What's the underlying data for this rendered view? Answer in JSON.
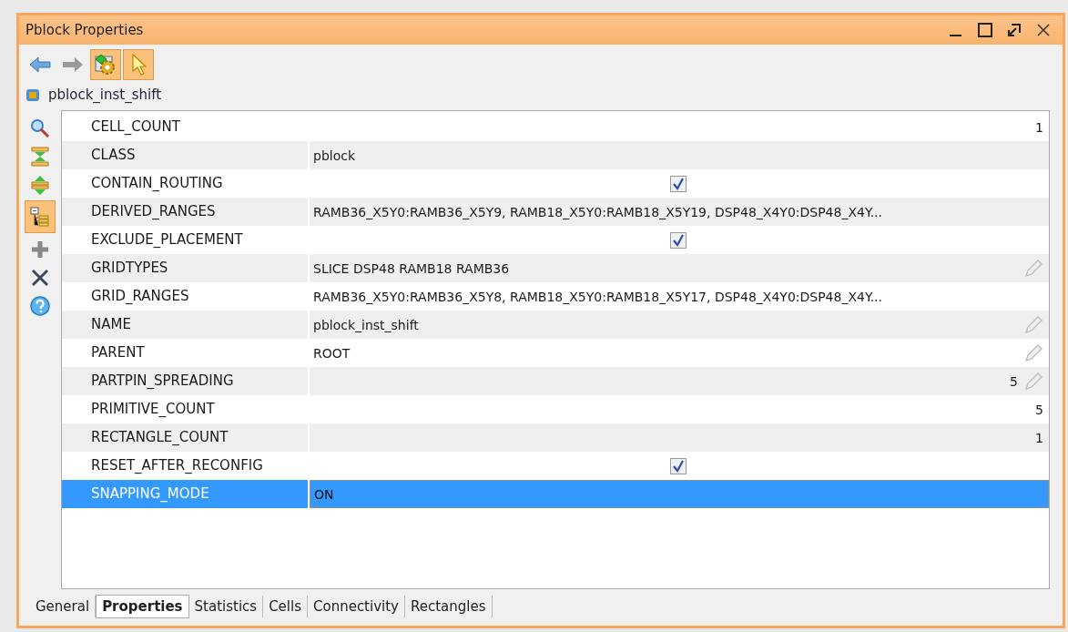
{
  "window": {
    "title": "Pblock Properties"
  },
  "toolbar": [
    {
      "kind": "back",
      "selected": false
    },
    {
      "kind": "forward",
      "selected": false
    },
    {
      "kind": "gear",
      "selected": true
    },
    {
      "kind": "cursor",
      "selected": true
    }
  ],
  "object": {
    "name": "pblock_inst_shift"
  },
  "side_tools": [
    {
      "kind": "search",
      "selected": false
    },
    {
      "kind": "collapse",
      "selected": false
    },
    {
      "kind": "expand",
      "selected": false
    },
    {
      "kind": "tree",
      "selected": true
    },
    {
      "kind": "add",
      "selected": false
    },
    {
      "kind": "remove",
      "selected": false
    },
    {
      "kind": "help",
      "selected": false
    }
  ],
  "properties": [
    {
      "name": "CELL_COUNT",
      "kind": "number",
      "value": "1",
      "editable": false,
      "selected": false
    },
    {
      "name": "CLASS",
      "kind": "text",
      "value": "pblock",
      "editable": false,
      "selected": false
    },
    {
      "name": "CONTAIN_ROUTING",
      "kind": "checkbox",
      "checked": true,
      "editable": false,
      "selected": false
    },
    {
      "name": "DERIVED_RANGES",
      "kind": "text",
      "value": "RAMB36_X5Y0:RAMB36_X5Y9, RAMB18_X5Y0:RAMB18_X5Y19, DSP48_X4Y0:DSP48_X4Y...",
      "editable": false,
      "selected": false
    },
    {
      "name": "EXCLUDE_PLACEMENT",
      "kind": "checkbox",
      "checked": true,
      "editable": false,
      "selected": false
    },
    {
      "name": "GRIDTYPES",
      "kind": "text",
      "value": "SLICE DSP48 RAMB18 RAMB36",
      "editable": true,
      "selected": false
    },
    {
      "name": "GRID_RANGES",
      "kind": "text",
      "value": "RAMB36_X5Y0:RAMB36_X5Y8, RAMB18_X5Y0:RAMB18_X5Y17, DSP48_X4Y0:DSP48_X4Y...",
      "editable": false,
      "selected": false
    },
    {
      "name": "NAME",
      "kind": "text",
      "value": "pblock_inst_shift",
      "editable": true,
      "selected": false
    },
    {
      "name": "PARENT",
      "kind": "text",
      "value": "ROOT",
      "editable": true,
      "selected": false
    },
    {
      "name": "PARTPIN_SPREADING",
      "kind": "number",
      "value": "5",
      "editable": true,
      "selected": false
    },
    {
      "name": "PRIMITIVE_COUNT",
      "kind": "number",
      "value": "5",
      "editable": false,
      "selected": false
    },
    {
      "name": "RECTANGLE_COUNT",
      "kind": "number",
      "value": "1",
      "editable": false,
      "selected": false
    },
    {
      "name": "RESET_AFTER_RECONFIG",
      "kind": "checkbox",
      "checked": true,
      "editable": false,
      "selected": false
    },
    {
      "name": "SNAPPING_MODE",
      "kind": "text",
      "value": "ON",
      "editable": false,
      "selected": true
    }
  ],
  "tabs": [
    {
      "label": "General",
      "selected": false
    },
    {
      "label": "Properties",
      "selected": true
    },
    {
      "label": "Statistics",
      "selected": false
    },
    {
      "label": "Cells",
      "selected": false
    },
    {
      "label": "Connectivity",
      "selected": false
    },
    {
      "label": "Rectangles",
      "selected": false
    }
  ]
}
